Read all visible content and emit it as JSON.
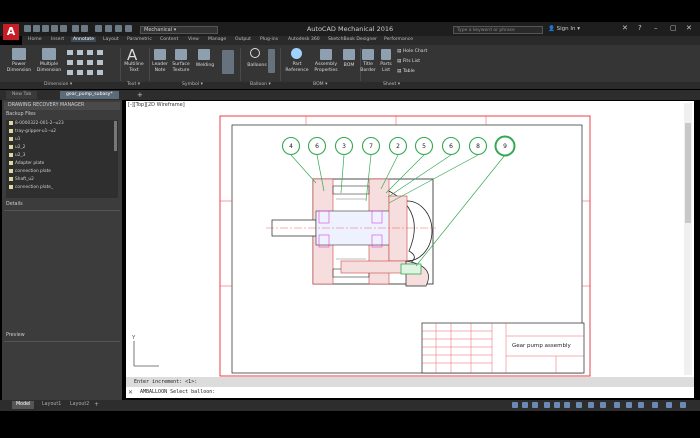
{
  "app": {
    "title": "AutoCAD Mechanical 2016",
    "workspace": "Mechanical",
    "search_placeholder": "Type a keyword or phrase",
    "sign_in": "Sign In"
  },
  "ribbon_tabs": [
    "Home",
    "Insert",
    "Annotate",
    "Layout",
    "Parametric",
    "Content",
    "View",
    "Manage",
    "Output",
    "Plug-ins",
    "Autodesk 360",
    "SketchBook Designer",
    "Performance"
  ],
  "ribbon_active_tab": "Annotate",
  "ribbon_buttons": {
    "power_dimension": "Power\nDimension",
    "multiple_dimension": "Multiple\nDimension",
    "multiline_text": "Multiline\nText",
    "leader_note": "Leader\nNote",
    "surface_texture": "Surface\nTexture",
    "welding": "Welding",
    "balloons": "Balloons",
    "part_reference": "Part\nReference",
    "assembly_properties": "Assembly\nProperties",
    "bom": "BOM",
    "title_border": "Title\nBorder",
    "parts_list": "Parts\nList",
    "hole_chart": "Hole Chart",
    "fits_list": "Fits List",
    "table": "Table"
  },
  "ribbon_panels": [
    "Dimension",
    "Text",
    "Symbol",
    "Balloon",
    "BOM",
    "Sheet"
  ],
  "doc_tabs": [
    "New Tab",
    "gear_pump_subasy*"
  ],
  "left_panel": {
    "title": "DRAWING RECOVERY MANAGER",
    "backup_header": "Backup Files",
    "files": [
      "8-0000322-001-2--u23",
      "tray-gripper-u1--u2",
      "u1",
      "u2_2",
      "u2_3",
      "Adapter plate",
      "connection plate",
      "Shaft_u2",
      "connection plate_"
    ],
    "details": "Details",
    "preview": "Preview"
  },
  "viewport_label": "[-][Top][2D Wireframe]",
  "balloons": [
    "4",
    "6",
    "3",
    "7",
    "2",
    "5",
    "6",
    "8",
    "9"
  ],
  "title_block_text": "Gear pump assembly",
  "command_history": "Enter increment: <1>:",
  "command_line": "AMBALLOON Select balloon:",
  "layout_tabs": [
    "Model",
    "Layout1",
    "Layout2"
  ],
  "colors": {
    "accent": "#c51f25",
    "border_red": "#e8404a",
    "balloon_green": "#34a853"
  }
}
